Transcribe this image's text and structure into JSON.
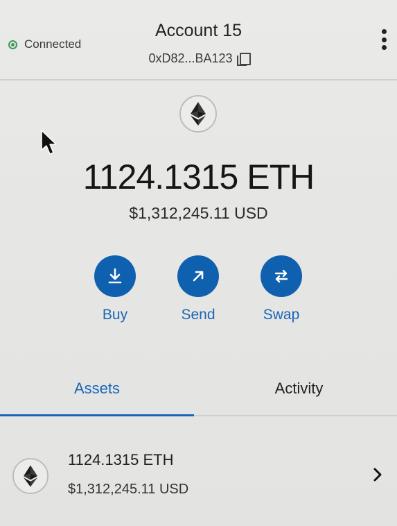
{
  "header": {
    "status": "Connected",
    "account_name": "Account 15",
    "address": "0xD82...BA123"
  },
  "balance": {
    "amount": "1124.1315 ETH",
    "fiat": "$1,312,245.11 USD"
  },
  "actions": [
    {
      "label": "Buy",
      "icon": "download-icon"
    },
    {
      "label": "Send",
      "icon": "arrow-up-right-icon"
    },
    {
      "label": "Swap",
      "icon": "swap-arrows-icon"
    }
  ],
  "tabs": [
    {
      "label": "Assets",
      "active": true
    },
    {
      "label": "Activity",
      "active": false
    }
  ],
  "assets": [
    {
      "amount": "1124.1315 ETH",
      "fiat": "$1,312,245.11 USD",
      "icon": "ethereum-icon"
    }
  ],
  "colors": {
    "accent": "#1060b0",
    "accent_text": "#1a66b8",
    "connected": "#3a9a5a",
    "background": "#e8e8e6"
  }
}
